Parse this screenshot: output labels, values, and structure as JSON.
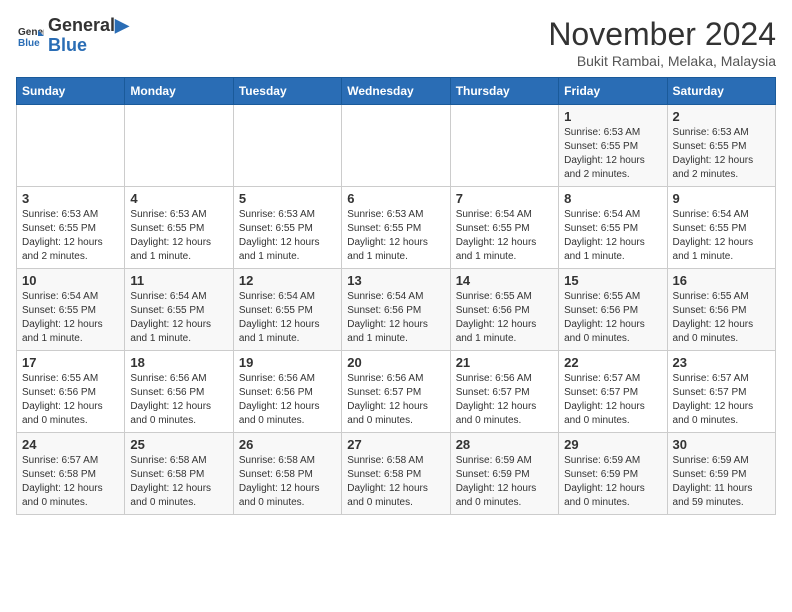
{
  "header": {
    "logo_line1": "General",
    "logo_line2": "Blue",
    "month": "November 2024",
    "location": "Bukit Rambai, Melaka, Malaysia"
  },
  "weekdays": [
    "Sunday",
    "Monday",
    "Tuesday",
    "Wednesday",
    "Thursday",
    "Friday",
    "Saturday"
  ],
  "weeks": [
    [
      {
        "day": "",
        "info": ""
      },
      {
        "day": "",
        "info": ""
      },
      {
        "day": "",
        "info": ""
      },
      {
        "day": "",
        "info": ""
      },
      {
        "day": "",
        "info": ""
      },
      {
        "day": "1",
        "info": "Sunrise: 6:53 AM\nSunset: 6:55 PM\nDaylight: 12 hours and 2 minutes."
      },
      {
        "day": "2",
        "info": "Sunrise: 6:53 AM\nSunset: 6:55 PM\nDaylight: 12 hours and 2 minutes."
      }
    ],
    [
      {
        "day": "3",
        "info": "Sunrise: 6:53 AM\nSunset: 6:55 PM\nDaylight: 12 hours and 2 minutes."
      },
      {
        "day": "4",
        "info": "Sunrise: 6:53 AM\nSunset: 6:55 PM\nDaylight: 12 hours and 1 minute."
      },
      {
        "day": "5",
        "info": "Sunrise: 6:53 AM\nSunset: 6:55 PM\nDaylight: 12 hours and 1 minute."
      },
      {
        "day": "6",
        "info": "Sunrise: 6:53 AM\nSunset: 6:55 PM\nDaylight: 12 hours and 1 minute."
      },
      {
        "day": "7",
        "info": "Sunrise: 6:54 AM\nSunset: 6:55 PM\nDaylight: 12 hours and 1 minute."
      },
      {
        "day": "8",
        "info": "Sunrise: 6:54 AM\nSunset: 6:55 PM\nDaylight: 12 hours and 1 minute."
      },
      {
        "day": "9",
        "info": "Sunrise: 6:54 AM\nSunset: 6:55 PM\nDaylight: 12 hours and 1 minute."
      }
    ],
    [
      {
        "day": "10",
        "info": "Sunrise: 6:54 AM\nSunset: 6:55 PM\nDaylight: 12 hours and 1 minute."
      },
      {
        "day": "11",
        "info": "Sunrise: 6:54 AM\nSunset: 6:55 PM\nDaylight: 12 hours and 1 minute."
      },
      {
        "day": "12",
        "info": "Sunrise: 6:54 AM\nSunset: 6:55 PM\nDaylight: 12 hours and 1 minute."
      },
      {
        "day": "13",
        "info": "Sunrise: 6:54 AM\nSunset: 6:56 PM\nDaylight: 12 hours and 1 minute."
      },
      {
        "day": "14",
        "info": "Sunrise: 6:55 AM\nSunset: 6:56 PM\nDaylight: 12 hours and 1 minute."
      },
      {
        "day": "15",
        "info": "Sunrise: 6:55 AM\nSunset: 6:56 PM\nDaylight: 12 hours and 0 minutes."
      },
      {
        "day": "16",
        "info": "Sunrise: 6:55 AM\nSunset: 6:56 PM\nDaylight: 12 hours and 0 minutes."
      }
    ],
    [
      {
        "day": "17",
        "info": "Sunrise: 6:55 AM\nSunset: 6:56 PM\nDaylight: 12 hours and 0 minutes."
      },
      {
        "day": "18",
        "info": "Sunrise: 6:56 AM\nSunset: 6:56 PM\nDaylight: 12 hours and 0 minutes."
      },
      {
        "day": "19",
        "info": "Sunrise: 6:56 AM\nSunset: 6:56 PM\nDaylight: 12 hours and 0 minutes."
      },
      {
        "day": "20",
        "info": "Sunrise: 6:56 AM\nSunset: 6:57 PM\nDaylight: 12 hours and 0 minutes."
      },
      {
        "day": "21",
        "info": "Sunrise: 6:56 AM\nSunset: 6:57 PM\nDaylight: 12 hours and 0 minutes."
      },
      {
        "day": "22",
        "info": "Sunrise: 6:57 AM\nSunset: 6:57 PM\nDaylight: 12 hours and 0 minutes."
      },
      {
        "day": "23",
        "info": "Sunrise: 6:57 AM\nSunset: 6:57 PM\nDaylight: 12 hours and 0 minutes."
      }
    ],
    [
      {
        "day": "24",
        "info": "Sunrise: 6:57 AM\nSunset: 6:58 PM\nDaylight: 12 hours and 0 minutes."
      },
      {
        "day": "25",
        "info": "Sunrise: 6:58 AM\nSunset: 6:58 PM\nDaylight: 12 hours and 0 minutes."
      },
      {
        "day": "26",
        "info": "Sunrise: 6:58 AM\nSunset: 6:58 PM\nDaylight: 12 hours and 0 minutes."
      },
      {
        "day": "27",
        "info": "Sunrise: 6:58 AM\nSunset: 6:58 PM\nDaylight: 12 hours and 0 minutes."
      },
      {
        "day": "28",
        "info": "Sunrise: 6:59 AM\nSunset: 6:59 PM\nDaylight: 12 hours and 0 minutes."
      },
      {
        "day": "29",
        "info": "Sunrise: 6:59 AM\nSunset: 6:59 PM\nDaylight: 12 hours and 0 minutes."
      },
      {
        "day": "30",
        "info": "Sunrise: 6:59 AM\nSunset: 6:59 PM\nDaylight: 11 hours and 59 minutes."
      }
    ]
  ]
}
